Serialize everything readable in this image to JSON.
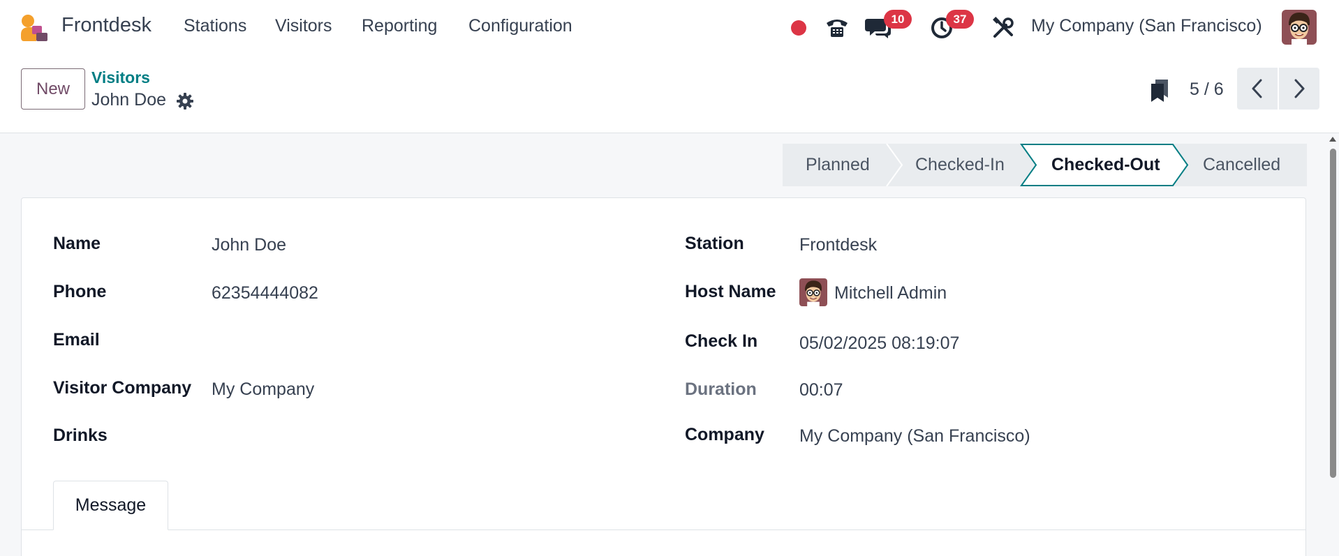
{
  "navbar": {
    "app_name": "Frontdesk",
    "menu": [
      "Stations",
      "Visitors",
      "Reporting",
      "Configuration"
    ],
    "company": "My Company (San Francisco)",
    "messages_count": "10",
    "activities_count": "37"
  },
  "control_panel": {
    "new_label": "New",
    "breadcrumb_parent": "Visitors",
    "record_name": "John Doe",
    "pager_value": "5 / 6"
  },
  "statusbar": {
    "stages": [
      "Planned",
      "Checked-In",
      "Checked-Out",
      "Cancelled"
    ],
    "active": "Checked-Out"
  },
  "form": {
    "left": [
      {
        "label": "Name",
        "value": "John Doe"
      },
      {
        "label": "Phone",
        "value": "62354444082"
      },
      {
        "label": "Email",
        "value": ""
      },
      {
        "label": "Visitor Company",
        "value": "My Company"
      },
      {
        "label": "Drinks",
        "value": ""
      }
    ],
    "right": [
      {
        "label": "Station",
        "value": "Frontdesk"
      },
      {
        "label": "Host Name",
        "value": "Mitchell Admin"
      },
      {
        "label": "Check In",
        "value": "05/02/2025 08:19:07"
      },
      {
        "label": "Duration",
        "value": "00:07"
      },
      {
        "label": "Company",
        "value": "My Company (San Francisco)"
      }
    ],
    "tabs": [
      "Message"
    ]
  },
  "colors": {
    "brand": "#714b67",
    "link": "#017e84",
    "badge": "#dc3545",
    "recording_dot": "#dc3545",
    "status_active_border": "#017e84"
  },
  "icons": {
    "app_logo": "frontdesk-logo-icon",
    "record": "recording-dot-icon",
    "phone": "phone-icon",
    "messages": "chat-icon",
    "activities": "clock-icon",
    "debug": "tools-icon",
    "gear": "gear-icon",
    "bookmark": "bookmark-icon",
    "prev": "chevron-left-icon",
    "next": "chevron-right-icon"
  }
}
